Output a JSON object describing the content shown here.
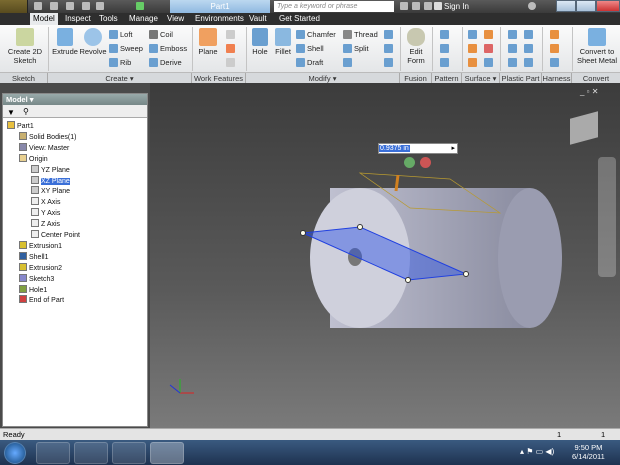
{
  "window": {
    "title": "Part1",
    "search_placeholder": "Type a keyword or phrase",
    "sign_in": "Sign In"
  },
  "tabs": [
    "Model",
    "Inspect",
    "Tools",
    "Manage",
    "View",
    "Environments",
    "Vault",
    "Get Started"
  ],
  "ribbon": {
    "sketch": {
      "create": "Create 2D Sketch",
      "label": "Sketch"
    },
    "create": {
      "extrude": "Extrude",
      "revolve": "Revolve",
      "loft": "Loft",
      "sweep": "Sweep",
      "rib": "Rib",
      "coil": "Coil",
      "emboss": "Emboss",
      "derive": "Derive",
      "label": "Create ▾"
    },
    "work": {
      "plane": "Plane",
      "label": "Work Features"
    },
    "modify": {
      "hole": "Hole",
      "fillet": "Fillet",
      "chamfer": "Chamfer",
      "shell": "Shell",
      "draft": "Draft",
      "thread": "Thread",
      "split": "Split",
      "label": "Modify ▾"
    },
    "fusion": {
      "edit_form": "Edit Form",
      "label": "Fusion"
    },
    "pattern": {
      "label": "Pattern"
    },
    "surface": {
      "label": "Surface ▾"
    },
    "plastic": {
      "label": "Plastic Part"
    },
    "harness": {
      "label": "Harness"
    },
    "convert": {
      "button": "Convert to Sheet Metal",
      "label": "Convert"
    }
  },
  "browser": {
    "title": "Model ▾",
    "tree": [
      "Part1",
      "Solid Bodies(1)",
      "View: Master",
      "Origin",
      "YZ Plane",
      "XZ Plane",
      "XY Plane",
      "X Axis",
      "Y Axis",
      "Z Axis",
      "Center Point",
      "Extrusion1",
      "Shell1",
      "Extrusion2",
      "Sketch3",
      "Hole1",
      "End of Part"
    ],
    "selected": "XZ Plane"
  },
  "viewport": {
    "dimension_value": "0.9375 in"
  },
  "status": {
    "text": "Ready",
    "count1": "1",
    "count2": "1"
  },
  "taskbar": {
    "time": "9:50 PM",
    "date": "6/14/2011"
  }
}
